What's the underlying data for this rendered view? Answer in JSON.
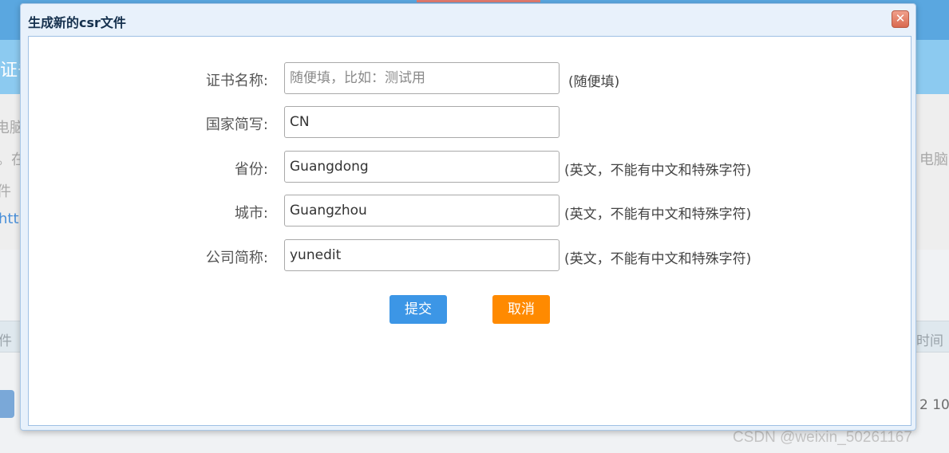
{
  "background": {
    "banner_text": "证书",
    "lines": [
      "电脑的",
      "。在",
      "件（",
      "htt"
    ],
    "right_line": "电脑",
    "table_head_left": "件",
    "table_head_right": "时间",
    "right_cell": "2 10",
    "watermark": "CSDN @weixin_50261167"
  },
  "dialog": {
    "title": "生成新的csr文件",
    "close_symbol": "✕",
    "fields": [
      {
        "label": "证书名称:",
        "value": "",
        "placeholder": "随便填，比如：测试用",
        "hint": "(随便填)"
      },
      {
        "label": "国家简写:",
        "value": "CN",
        "placeholder": "",
        "hint": ""
      },
      {
        "label": "省份:",
        "value": "Guangdong",
        "placeholder": "",
        "hint": "(英文，不能有中文和特殊字符)"
      },
      {
        "label": "城市:",
        "value": "Guangzhou",
        "placeholder": "",
        "hint": "(英文，不能有中文和特殊字符)"
      },
      {
        "label": "公司简称:",
        "value": "yunedit",
        "placeholder": "",
        "hint": "(英文，不能有中文和特殊字符)"
      }
    ],
    "submit_label": "提交",
    "cancel_label": "取消"
  },
  "colors": {
    "submit": "#3c96e6",
    "cancel": "#ff8a00",
    "dialog_border": "#a9c7e6",
    "close": "#d9694f"
  }
}
